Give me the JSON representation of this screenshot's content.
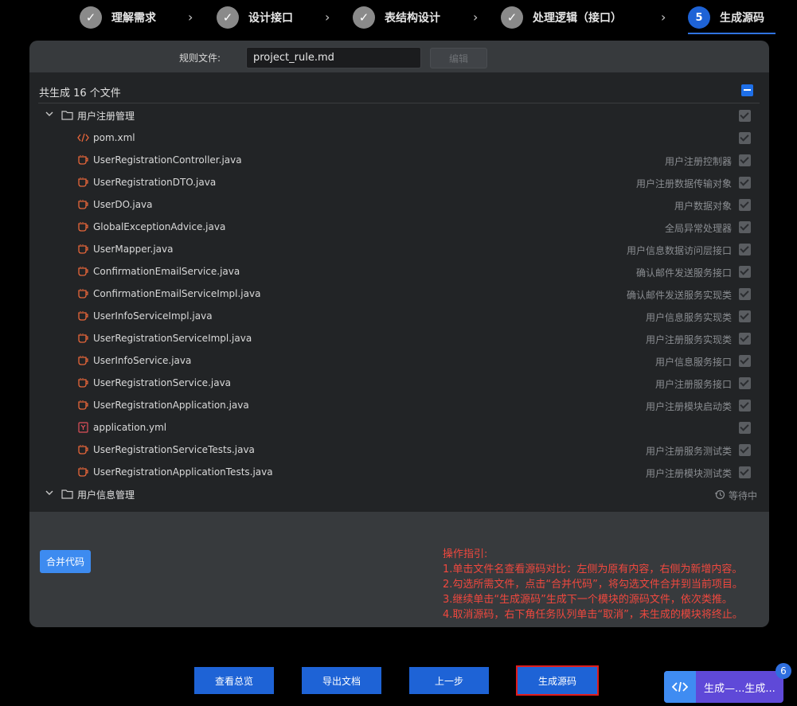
{
  "steps": [
    {
      "label": "理解需求",
      "state": "done",
      "mark": "✓"
    },
    {
      "label": "设计接口",
      "state": "done",
      "mark": "✓"
    },
    {
      "label": "表结构设计",
      "state": "done",
      "mark": "✓"
    },
    {
      "label": "处理逻辑（接口）",
      "state": "done",
      "mark": "✓"
    },
    {
      "label": "生成源码",
      "state": "active",
      "mark": "5"
    }
  ],
  "rule": {
    "label": "规则文件:",
    "value": "project_rule.md",
    "edit_label": "编辑"
  },
  "summary": "共生成 16 个文件",
  "groups": [
    {
      "label": "用户注册管理",
      "files": [
        {
          "name": "pom.xml",
          "desc": "",
          "icon": "xml-icon"
        },
        {
          "name": "UserRegistrationController.java",
          "desc": "用户注册控制器",
          "icon": "java-icon"
        },
        {
          "name": "UserRegistrationDTO.java",
          "desc": "用户注册数据传输对象",
          "icon": "java-icon"
        },
        {
          "name": "UserDO.java",
          "desc": "用户数据对象",
          "icon": "java-icon"
        },
        {
          "name": "GlobalExceptionAdvice.java",
          "desc": "全局异常处理器",
          "icon": "java-icon"
        },
        {
          "name": "UserMapper.java",
          "desc": "用户信息数据访问层接口",
          "icon": "java-icon"
        },
        {
          "name": "ConfirmationEmailService.java",
          "desc": "确认邮件发送服务接口",
          "icon": "java-icon"
        },
        {
          "name": "ConfirmationEmailServiceImpl.java",
          "desc": "确认邮件发送服务实现类",
          "icon": "java-icon"
        },
        {
          "name": "UserInfoServiceImpl.java",
          "desc": "用户信息服务实现类",
          "icon": "java-icon"
        },
        {
          "name": "UserRegistrationServiceImpl.java",
          "desc": "用户注册服务实现类",
          "icon": "java-icon"
        },
        {
          "name": "UserInfoService.java",
          "desc": "用户信息服务接口",
          "icon": "java-icon"
        },
        {
          "name": "UserRegistrationService.java",
          "desc": "用户注册服务接口",
          "icon": "java-icon"
        },
        {
          "name": "UserRegistrationApplication.java",
          "desc": "用户注册模块启动类",
          "icon": "java-icon"
        },
        {
          "name": "application.yml",
          "desc": "",
          "icon": "yml-icon"
        },
        {
          "name": "UserRegistrationServiceTests.java",
          "desc": "用户注册服务测试类",
          "icon": "java-icon"
        },
        {
          "name": "UserRegistrationApplicationTests.java",
          "desc": "用户注册模块测试类",
          "icon": "java-icon"
        }
      ]
    },
    {
      "label": "用户信息管理",
      "status": "等待中"
    }
  ],
  "merge_label": "合并代码",
  "guide": [
    "操作指引:",
    "1.单击文件名查看源码对比：左侧为原有内容，右侧为新增内容。",
    "2.勾选所需文件，点击“合并代码”，将勾选文件合并到当前项目。",
    "3.继续单击“生成源码”生成下一个模块的源码文件，依次类推。",
    "4.取消源码，右下角任务队列单击“取消”，未生成的模块将终止。"
  ],
  "bottom_buttons": [
    "查看总览",
    "导出文档",
    "上一步",
    "生成源码"
  ],
  "task": {
    "text": "生成—...生成...",
    "badge": "6"
  },
  "colors": {
    "accent": "#1e63d6",
    "guide": "#f0483e",
    "task": "#5f49d8"
  }
}
